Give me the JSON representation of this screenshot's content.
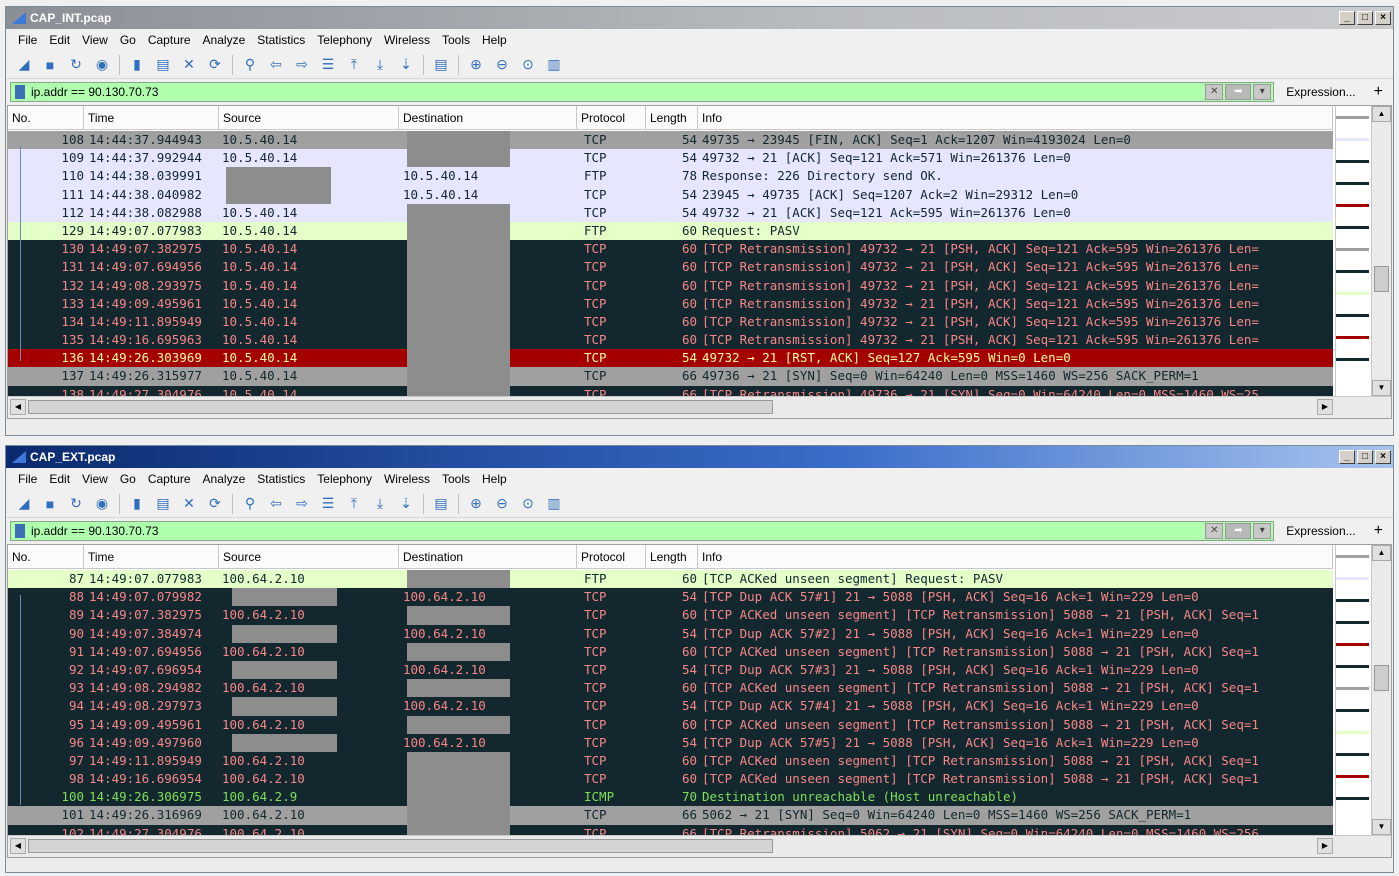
{
  "menu": [
    "File",
    "Edit",
    "View",
    "Go",
    "Capture",
    "Analyze",
    "Statistics",
    "Telephony",
    "Wireless",
    "Tools",
    "Help"
  ],
  "columns": {
    "no": "No.",
    "time": "Time",
    "source": "Source",
    "destination": "Destination",
    "protocol": "Protocol",
    "length": "Length",
    "info": "Info"
  },
  "expression_label": "Expression...",
  "plus_label": "+",
  "colors": {
    "selected_row": "#a40000",
    "filter_ok": "#afffaf",
    "dark_row": "#12272e"
  },
  "windows": [
    {
      "id": "int",
      "title": "CAP_INT.pcap",
      "filter": "ip.addr == 90.130.70.73",
      "rows": [
        {
          "no": "108",
          "time": "14:44:37.944943",
          "src": "10.5.40.14",
          "dst": "",
          "proto": "TCP",
          "len": "54",
          "info": "49735 → 23945 [FIN, ACK] Seq=1 Ack=1207 Win=4193024 Len=0",
          "style": "grey"
        },
        {
          "no": "109",
          "time": "14:44:37.992944",
          "src": "10.5.40.14",
          "dst": "",
          "proto": "TCP",
          "len": "54",
          "info": "49732 → 21 [ACK] Seq=121 Ack=571 Win=261376 Len=0",
          "style": "lav"
        },
        {
          "no": "110",
          "time": "14:44:38.039991",
          "src": "",
          "dst": "10.5.40.14",
          "proto": "FTP",
          "len": "78",
          "info": "Response: 226 Directory send OK.",
          "style": "lav"
        },
        {
          "no": "111",
          "time": "14:44:38.040982",
          "src": "",
          "dst": "10.5.40.14",
          "proto": "TCP",
          "len": "54",
          "info": "23945 → 49735 [ACK] Seq=1207 Ack=2 Win=29312 Len=0",
          "style": "lav"
        },
        {
          "no": "112",
          "time": "14:44:38.082988",
          "src": "10.5.40.14",
          "dst": "",
          "proto": "TCP",
          "len": "54",
          "info": "49732 → 21 [ACK] Seq=121 Ack=595 Win=261376 Len=0",
          "style": "lav"
        },
        {
          "no": "129",
          "time": "14:49:07.077983",
          "src": "10.5.40.14",
          "dst": "",
          "proto": "FTP",
          "len": "60",
          "info": "Request: PASV",
          "style": "light"
        },
        {
          "no": "130",
          "time": "14:49:07.382975",
          "src": "10.5.40.14",
          "dst": "",
          "proto": "TCP",
          "len": "60",
          "info": "[TCP Retransmission] 49732 → 21 [PSH, ACK] Seq=121 Ack=595 Win=261376 Len=",
          "style": "dark"
        },
        {
          "no": "131",
          "time": "14:49:07.694956",
          "src": "10.5.40.14",
          "dst": "",
          "proto": "TCP",
          "len": "60",
          "info": "[TCP Retransmission] 49732 → 21 [PSH, ACK] Seq=121 Ack=595 Win=261376 Len=",
          "style": "dark"
        },
        {
          "no": "132",
          "time": "14:49:08.293975",
          "src": "10.5.40.14",
          "dst": "",
          "proto": "TCP",
          "len": "60",
          "info": "[TCP Retransmission] 49732 → 21 [PSH, ACK] Seq=121 Ack=595 Win=261376 Len=",
          "style": "dark"
        },
        {
          "no": "133",
          "time": "14:49:09.495961",
          "src": "10.5.40.14",
          "dst": "",
          "proto": "TCP",
          "len": "60",
          "info": "[TCP Retransmission] 49732 → 21 [PSH, ACK] Seq=121 Ack=595 Win=261376 Len=",
          "style": "dark"
        },
        {
          "no": "134",
          "time": "14:49:11.895949",
          "src": "10.5.40.14",
          "dst": "",
          "proto": "TCP",
          "len": "60",
          "info": "[TCP Retransmission] 49732 → 21 [PSH, ACK] Seq=121 Ack=595 Win=261376 Len=",
          "style": "dark"
        },
        {
          "no": "135",
          "time": "14:49:16.695963",
          "src": "10.5.40.14",
          "dst": "",
          "proto": "TCP",
          "len": "60",
          "info": "[TCP Retransmission] 49732 → 21 [PSH, ACK] Seq=121 Ack=595 Win=261376 Len=",
          "style": "dark"
        },
        {
          "no": "136",
          "time": "14:49:26.303969",
          "src": "10.5.40.14",
          "dst": "",
          "proto": "TCP",
          "len": "54",
          "info": "49732 → 21 [RST, ACK] Seq=127 Ack=595 Win=0 Len=0",
          "style": "sel"
        },
        {
          "no": "137",
          "time": "14:49:26.315977",
          "src": "10.5.40.14",
          "dst": "",
          "proto": "TCP",
          "len": "66",
          "info": "49736 → 21 [SYN] Seq=0 Win=64240 Len=0 MSS=1460 WS=256 SACK_PERM=1",
          "style": "grey"
        },
        {
          "no": "138",
          "time": "14:49:27.304976",
          "src": "10.5.40.14",
          "dst": "",
          "proto": "TCP",
          "len": "66",
          "info": "[TCP Retransmission] 49736 → 21 [SYN] Seq=0 Win=64240 Len=0 MSS=1460 WS=25",
          "style": "dark"
        }
      ]
    },
    {
      "id": "ext",
      "title": "CAP_EXT.pcap",
      "filter": "ip.addr == 90.130.70.73",
      "rows": [
        {
          "no": "87",
          "time": "14:49:07.077983",
          "src": "100.64.2.10",
          "dst": "",
          "proto": "FTP",
          "len": "60",
          "info": "[TCP ACKed unseen segment] Request: PASV",
          "style": "light"
        },
        {
          "no": "88",
          "time": "14:49:07.079982",
          "src": "",
          "dst": "100.64.2.10",
          "proto": "TCP",
          "len": "54",
          "info": "[TCP Dup ACK 57#1] 21 → 5088 [PSH, ACK] Seq=16 Ack=1 Win=229 Len=0",
          "style": "dark"
        },
        {
          "no": "89",
          "time": "14:49:07.382975",
          "src": "100.64.2.10",
          "dst": "",
          "proto": "TCP",
          "len": "60",
          "info": "[TCP ACKed unseen segment] [TCP Retransmission] 5088 → 21 [PSH, ACK] Seq=1",
          "style": "dark"
        },
        {
          "no": "90",
          "time": "14:49:07.384974",
          "src": "",
          "dst": "100.64.2.10",
          "proto": "TCP",
          "len": "54",
          "info": "[TCP Dup ACK 57#2] 21 → 5088 [PSH, ACK] Seq=16 Ack=1 Win=229 Len=0",
          "style": "dark"
        },
        {
          "no": "91",
          "time": "14:49:07.694956",
          "src": "100.64.2.10",
          "dst": "",
          "proto": "TCP",
          "len": "60",
          "info": "[TCP ACKed unseen segment] [TCP Retransmission] 5088 → 21 [PSH, ACK] Seq=1",
          "style": "dark"
        },
        {
          "no": "92",
          "time": "14:49:07.696954",
          "src": "",
          "dst": "100.64.2.10",
          "proto": "TCP",
          "len": "54",
          "info": "[TCP Dup ACK 57#3] 21 → 5088 [PSH, ACK] Seq=16 Ack=1 Win=229 Len=0",
          "style": "dark"
        },
        {
          "no": "93",
          "time": "14:49:08.294982",
          "src": "100.64.2.10",
          "dst": "",
          "proto": "TCP",
          "len": "60",
          "info": "[TCP ACKed unseen segment] [TCP Retransmission] 5088 → 21 [PSH, ACK] Seq=1",
          "style": "dark"
        },
        {
          "no": "94",
          "time": "14:49:08.297973",
          "src": "",
          "dst": "100.64.2.10",
          "proto": "TCP",
          "len": "54",
          "info": "[TCP Dup ACK 57#4] 21 → 5088 [PSH, ACK] Seq=16 Ack=1 Win=229 Len=0",
          "style": "dark"
        },
        {
          "no": "95",
          "time": "14:49:09.495961",
          "src": "100.64.2.10",
          "dst": "",
          "proto": "TCP",
          "len": "60",
          "info": "[TCP ACKed unseen segment] [TCP Retransmission] 5088 → 21 [PSH, ACK] Seq=1",
          "style": "dark"
        },
        {
          "no": "96",
          "time": "14:49:09.497960",
          "src": "",
          "dst": "100.64.2.10",
          "proto": "TCP",
          "len": "54",
          "info": "[TCP Dup ACK 57#5] 21 → 5088 [PSH, ACK] Seq=16 Ack=1 Win=229 Len=0",
          "style": "dark"
        },
        {
          "no": "97",
          "time": "14:49:11.895949",
          "src": "100.64.2.10",
          "dst": "",
          "proto": "TCP",
          "len": "60",
          "info": "[TCP ACKed unseen segment] [TCP Retransmission] 5088 → 21 [PSH, ACK] Seq=1",
          "style": "dark"
        },
        {
          "no": "98",
          "time": "14:49:16.696954",
          "src": "100.64.2.10",
          "dst": "",
          "proto": "TCP",
          "len": "60",
          "info": "[TCP ACKed unseen segment] [TCP Retransmission] 5088 → 21 [PSH, ACK] Seq=1",
          "style": "dark"
        },
        {
          "no": "100",
          "time": "14:49:26.306975",
          "src": "100.64.2.9",
          "dst": "",
          "proto": "ICMP",
          "len": "70",
          "info": "Destination unreachable (Host unreachable)",
          "style": "green"
        },
        {
          "no": "101",
          "time": "14:49:26.316969",
          "src": "100.64.2.10",
          "dst": "",
          "proto": "TCP",
          "len": "66",
          "info": "5062 → 21 [SYN] Seq=0 Win=64240 Len=0 MSS=1460 WS=256 SACK_PERM=1",
          "style": "grey"
        },
        {
          "no": "102",
          "time": "14:49:27.304976",
          "src": "100.64.2.10",
          "dst": "",
          "proto": "TCP",
          "len": "66",
          "info": "[TCP Retransmission] 5062 → 21 [SYN] Seq=0 Win=64240 Len=0 MSS=1460 WS=256",
          "style": "dark"
        }
      ]
    }
  ]
}
